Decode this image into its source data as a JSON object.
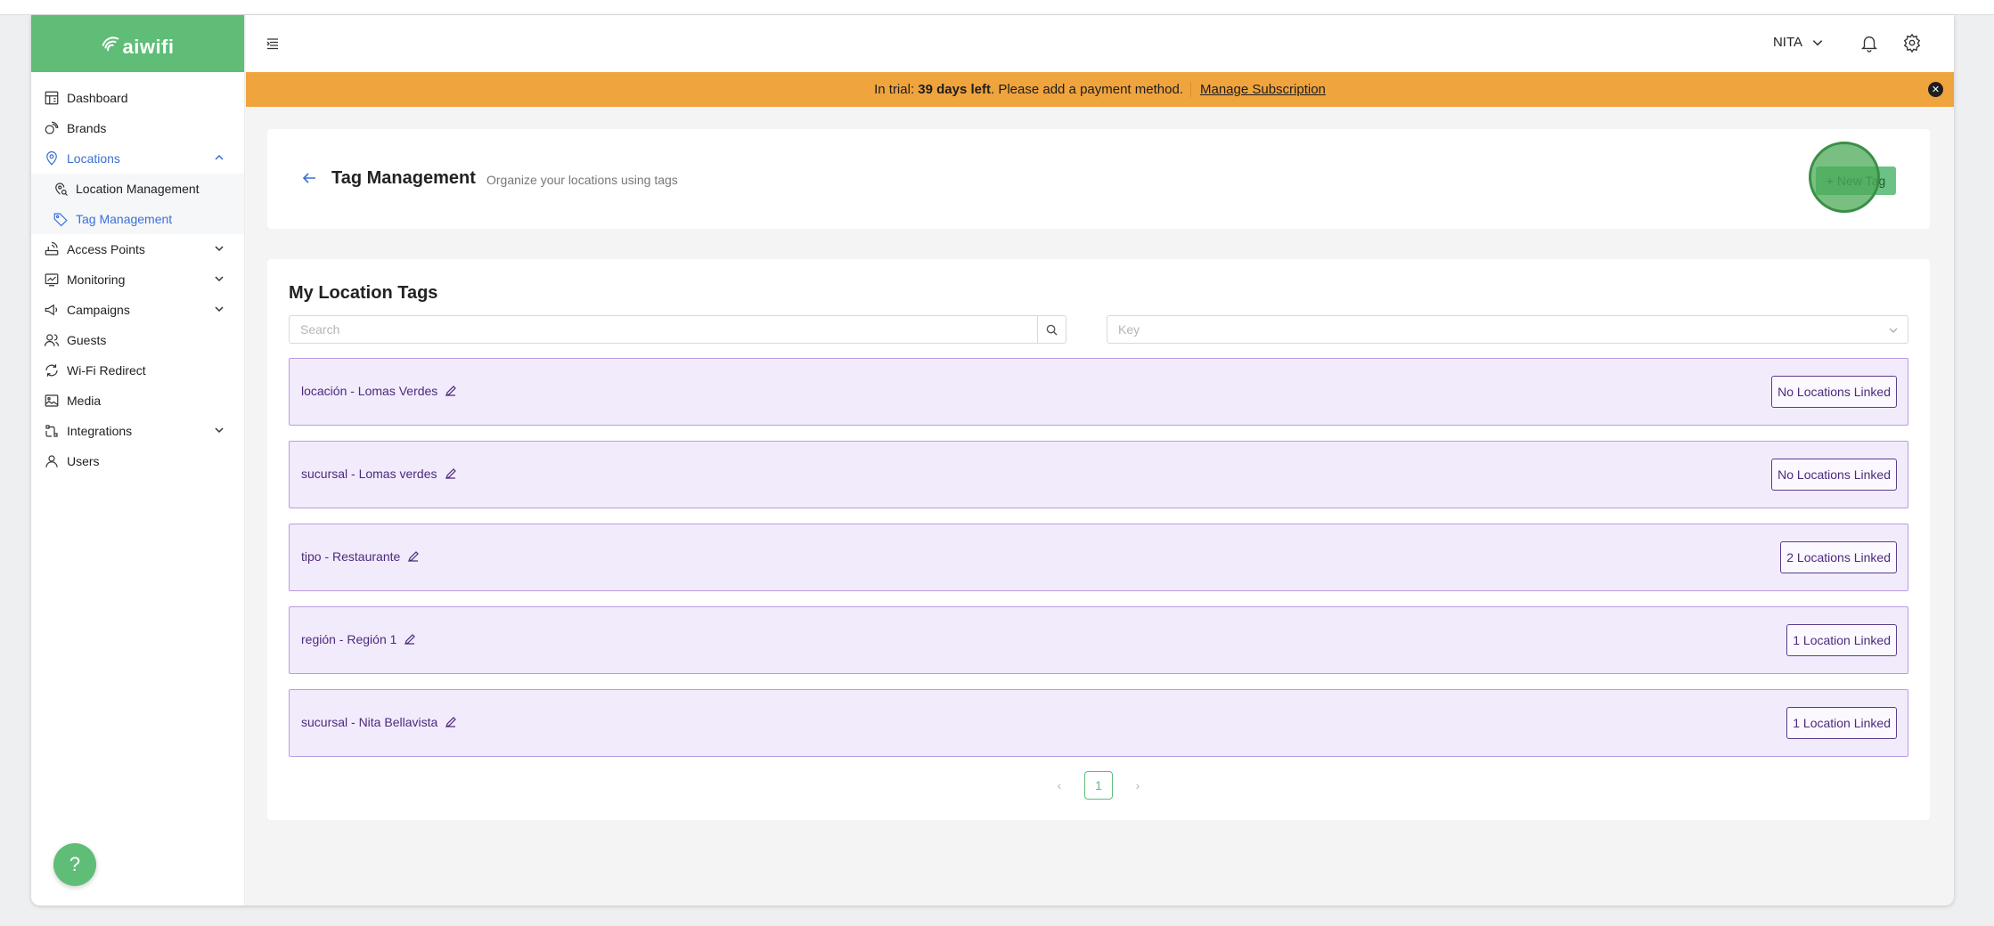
{
  "brand": {
    "name": "aiwifi",
    "accent": "#5fbd78"
  },
  "sidebar": {
    "items": [
      {
        "label": "Dashboard"
      },
      {
        "label": "Brands"
      },
      {
        "label": "Locations"
      },
      {
        "label": "Access Points"
      },
      {
        "label": "Monitoring"
      },
      {
        "label": "Campaigns"
      },
      {
        "label": "Guests"
      },
      {
        "label": "Wi-Fi Redirect"
      },
      {
        "label": "Media"
      },
      {
        "label": "Integrations"
      },
      {
        "label": "Users"
      }
    ],
    "locations_sub": [
      {
        "label": "Location Management"
      },
      {
        "label": "Tag Management"
      }
    ]
  },
  "header": {
    "user": "NITA"
  },
  "trial_banner": {
    "prefix": "In trial: ",
    "days": "39 days left",
    "suffix": ". Please add a payment method.",
    "link": "Manage Subscription",
    "color": "#f0a43e"
  },
  "page": {
    "title": "Tag Management",
    "subtitle": "Organize your locations using tags",
    "new_tag_label": "+ New Tag"
  },
  "tags_card": {
    "title": "My Location Tags",
    "search_placeholder": "Search",
    "key_placeholder": "Key",
    "rows": [
      {
        "name": "locación - Lomas Verdes",
        "linked": "No Locations Linked"
      },
      {
        "name": "sucursal - Lomas verdes",
        "linked": "No Locations Linked"
      },
      {
        "name": "tipo - Restaurante",
        "linked": "2 Locations Linked"
      },
      {
        "name": "región - Región 1",
        "linked": "1 Location Linked"
      },
      {
        "name": "sucursal - Nita Bellavista",
        "linked": "1 Location Linked"
      }
    ],
    "pagination": {
      "current": "1"
    }
  },
  "help": {
    "label": "?"
  }
}
